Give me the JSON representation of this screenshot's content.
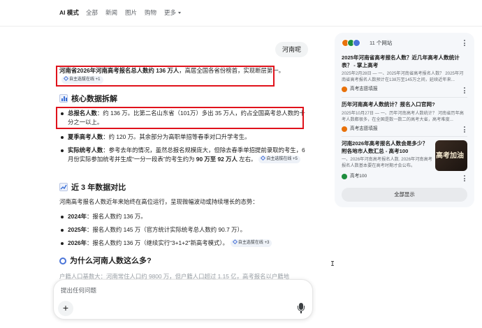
{
  "nav": {
    "tabs": [
      {
        "label": "AI 模式",
        "active": true
      },
      {
        "label": "全部",
        "active": false
      },
      {
        "label": "新闻",
        "active": false
      },
      {
        "label": "图片",
        "active": false
      },
      {
        "label": "购物",
        "active": false
      },
      {
        "label": "更多",
        "active": false
      }
    ]
  },
  "query": "河南呢",
  "answer": {
    "intro_bold": "河南省2026年河南高考报名总人数约 136 万人",
    "intro_rest": "，高居全国各省份榜首，实现断层第一。",
    "intro_chip": "自主选拔在线 +1",
    "section1_title": "核心数据拆解",
    "b1_label": "总报名人数",
    "b1_text": "：约 136 万。比第二名山东省（101万）多出 35 万人，约占全国高考总人数的十分之一以上。",
    "b2_label": "夏季高考人数",
    "b2_text": "：约 120 万。其余部分为高职单招等春季对口升学考生。",
    "b3_label": "实际统考人数",
    "b3_text_a": "：参考去年的情况，虽然总报名规模庞大，但除去春季单招提前录取的考生，6 月份实际参加统考并生成“一分一段表”的考生约为 ",
    "b3_text_b": "90 万至 92 万人",
    "b3_text_c": " 左右。",
    "b3_chip": "自主选拔在线 +5",
    "section2_title": "近 3 年数据对比",
    "section2_intro": "河南高考报名人数近年来始终在高位运行，呈现微幅波动或持续增长的态势：",
    "y1_label": "2024年",
    "y1_text": "：报名人数约 136 万。",
    "y2_label": "2025年",
    "y2_text": "：报名人数约 145 万（官方统计实际统考总人数约 90.7 万）。",
    "y3_label": "2026年",
    "y3_text": "：报名人数约 136 万（继续实行“3+1+2”新高考模式）。",
    "y3_chip": "自主选拔在线 +3",
    "section3_title": "为什么河南人数这么多?",
    "fade_text": "户籍人口基数大：河南常住人口约 9800 万，但户籍人口超过 1.15 亿，高考报名以户籍地"
  },
  "input": {
    "placeholder": "提出任何问题",
    "plus": "+"
  },
  "sources": {
    "count_label": "11 个网站",
    "items": [
      {
        "title": "2025年河南省高考报名人数？近几年高考人数统计表？ - 掌上高考",
        "snippet": "2025年2月28日 — 一、2025年河南省高考报名人数？ 2025年河南省高考报名人数预计在138万至145万之间，延续近年来...",
        "site": "高考志愿填报",
        "site_color": "#e8710a"
      },
      {
        "title": "历年河南高考人数统计？报名入口官网?",
        "snippet": "2025年10月27日 — 一、历年河南高考人数统计？ 河南省历年高考人数都很多，在全国是数一数二的高考大省，高考难度...",
        "site": "高考志愿填报",
        "site_color": "#e8710a"
      },
      {
        "title": "河南2026年高考报名人数会是多少？附各地市人数汇总 - 高考100",
        "snippet": "一、2026年河南高考报名人数. 2026年河南高考报名人数基本要在高考时期才会公布。",
        "site": "高考100",
        "site_color": "#1e8e3e",
        "thumb_text": "高考加油"
      }
    ],
    "show_all": "全部显示"
  },
  "colors": {
    "highlight_box": "#e0121b",
    "chip_bg": "#eef2f8",
    "panel_bg": "#f5f7fa"
  }
}
